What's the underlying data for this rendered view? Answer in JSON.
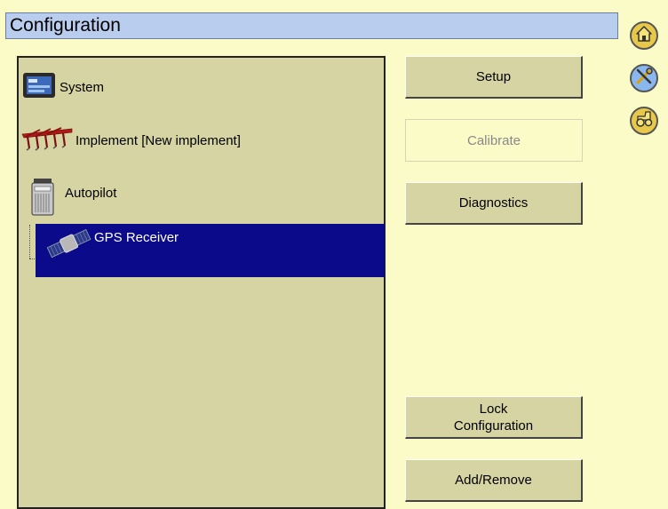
{
  "header": {
    "title": "Configuration"
  },
  "tree": {
    "items": [
      {
        "label": "System",
        "icon": "display-icon"
      },
      {
        "label": "Implement [New implement]",
        "icon": "cultivator-icon"
      },
      {
        "label": "Autopilot",
        "icon": "controller-icon"
      },
      {
        "label": "GPS Receiver",
        "icon": "satellite-icon",
        "selected": true
      }
    ]
  },
  "buttons": {
    "setup": "Setup",
    "calibrate": "Calibrate",
    "diagnostics": "Diagnostics",
    "lock": "Lock\nConfiguration",
    "add_remove": "Add/Remove"
  },
  "sidebar": [
    {
      "icon": "home-icon"
    },
    {
      "icon": "tools-icon"
    },
    {
      "icon": "tractor-icon"
    }
  ],
  "colors": {
    "background": "#fbfbc8",
    "panel": "#d6d4a3",
    "title_bar": "#b9cdee",
    "selection": "#0a0a8a",
    "icon_gold": "#e8c84a",
    "icon_blue": "#8ab8ee"
  }
}
